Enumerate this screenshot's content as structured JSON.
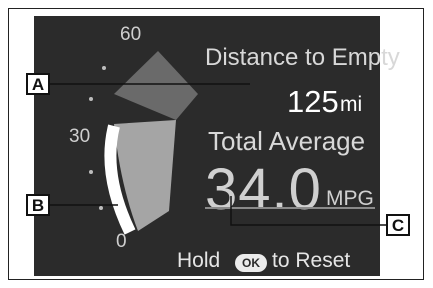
{
  "gauge": {
    "scale_labels": [
      "60",
      "30",
      "0"
    ],
    "fuel_level": 0.5,
    "colors": {
      "upper_sector": "#6a6a6a",
      "lower_sector": "#a5a5a5",
      "fuel_arc": "#ffffff",
      "screen": "#2b2b2b"
    }
  },
  "distance_to_empty": {
    "title": "Distance to Empty",
    "value": "125",
    "unit": "mi"
  },
  "total_average": {
    "title": "Total Average",
    "value": "34.0",
    "unit": "MPG"
  },
  "reset_hint": {
    "prefix": "Hold",
    "button_label": "OK",
    "suffix": "to Reset"
  },
  "callouts": {
    "a": "A",
    "b": "B",
    "c": "C"
  }
}
